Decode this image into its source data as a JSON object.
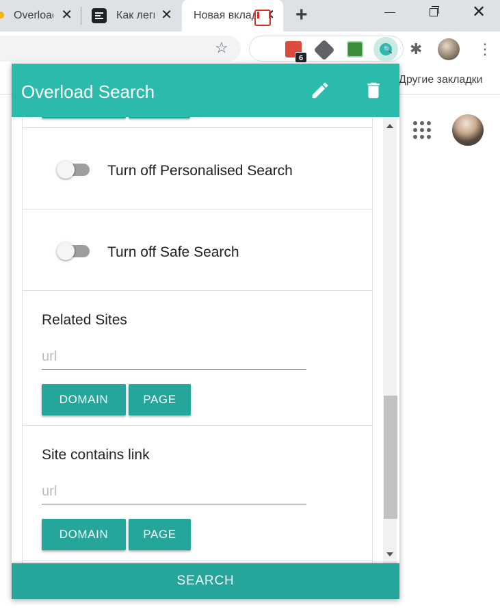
{
  "browser": {
    "tabs": [
      {
        "title": "Overload Search",
        "close": "✕"
      },
      {
        "title": "Как легко",
        "close": "✕"
      },
      {
        "title": "Новая вкладка",
        "close": "✕"
      }
    ],
    "new_tab": "+",
    "window_controls": {
      "minimize": "minimize-icon",
      "restore": "restore-icon",
      "close": "✕"
    },
    "star": "☆",
    "extensions": {
      "todoist_badge": "6",
      "overload_icon": "🔍",
      "puzzle": "✱",
      "menu": "⋮"
    },
    "bookmarks_other": "Другие закладки"
  },
  "popup": {
    "title": "Overload Search",
    "toggles": [
      {
        "label": "Turn off Personalised Search",
        "on": false
      },
      {
        "label": "Turn off Safe Search",
        "on": false
      }
    ],
    "sections": [
      {
        "title": "Related Sites",
        "placeholder": "url",
        "value": "",
        "domain_label": "DOMAIN",
        "page_label": "PAGE"
      },
      {
        "title": "Site contains link",
        "placeholder": "url",
        "value": "",
        "domain_label": "DOMAIN",
        "page_label": "PAGE"
      }
    ],
    "search_label": "SEARCH"
  },
  "colors": {
    "header": "#2bbbad",
    "button": "#26a69a",
    "tabstrip": "#dee1e6"
  }
}
